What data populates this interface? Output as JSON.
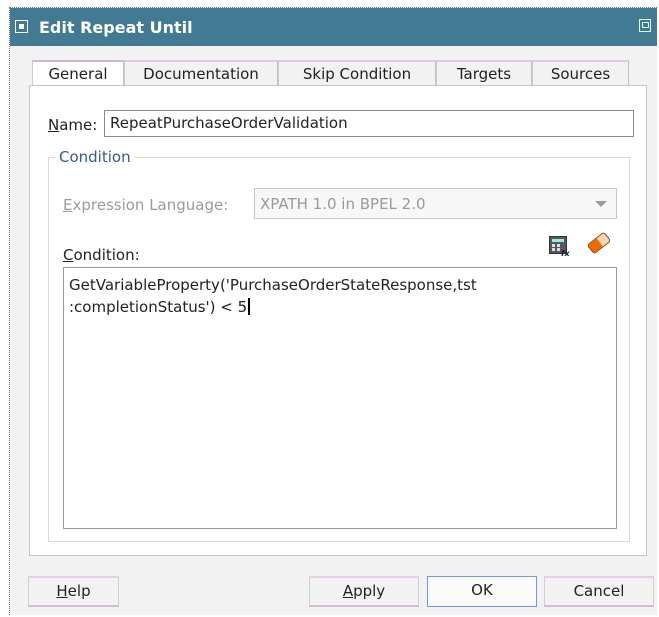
{
  "window": {
    "title": "Edit Repeat Until"
  },
  "tabs": [
    {
      "label": "General",
      "active": true
    },
    {
      "label": "Documentation",
      "active": false
    },
    {
      "label": "Skip Condition",
      "active": false
    },
    {
      "label": "Targets",
      "active": false
    },
    {
      "label": "Sources",
      "active": false
    }
  ],
  "general": {
    "name_label_mnemonic": "N",
    "name_label_rest": "ame:",
    "name_value": "RepeatPurchaseOrderValidation",
    "condition_group_title": "Condition",
    "expr_label_mnemonic": "E",
    "expr_label_rest": "xpression Language:",
    "expr_value": "XPATH 1.0 in BPEL 2.0",
    "condition_label_mnemonic": "C",
    "condition_label_rest": "ondition:",
    "condition_text": "GetVariableProperty('PurchaseOrderStateResponse,tst\n:completionStatus') < 5",
    "expression_builder_icon": "calculator-icon",
    "clear_icon": "eraser-icon"
  },
  "buttons": {
    "help_mnemonic": "H",
    "help_rest": "elp",
    "apply_mnemonic": "A",
    "apply_rest": "pply",
    "ok": "OK",
    "cancel": "Cancel"
  },
  "colors": {
    "titlebar": "#417a92",
    "group_title": "#385a86",
    "ok_border": "#6f9bd6"
  }
}
